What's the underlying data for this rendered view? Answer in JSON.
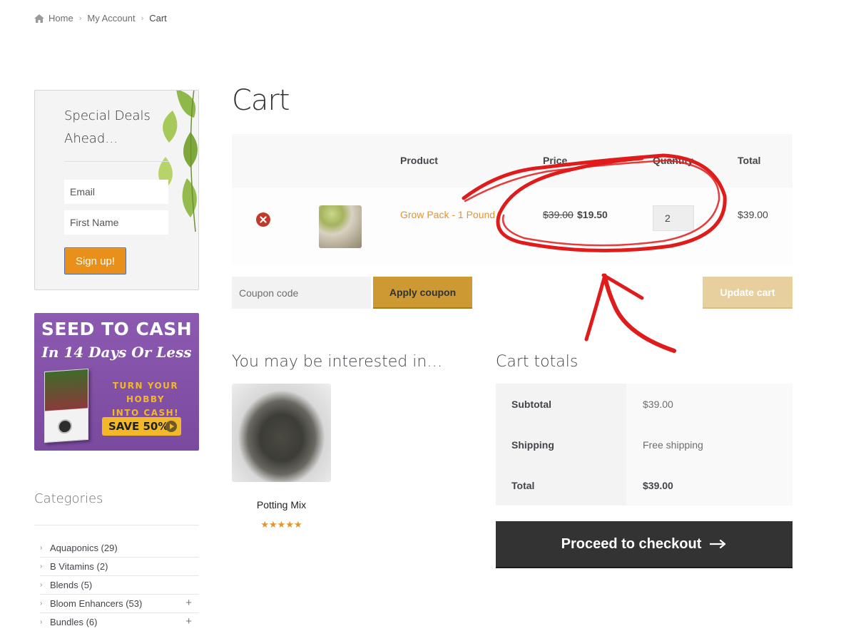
{
  "breadcrumb": {
    "home": "Home",
    "account": "My Account",
    "current": "Cart"
  },
  "newsletter": {
    "title": "Special Deals Ahead…",
    "email_placeholder": "Email",
    "name_placeholder": "First Name",
    "signup_label": "Sign up!"
  },
  "promo": {
    "title": "SEED TO CASH",
    "subtitle": "In 14 Days Or Less",
    "tagline_1": "TURN YOUR HOBBY",
    "tagline_2": "INTO CASH!",
    "save": "SAVE 50%"
  },
  "categories": {
    "title": "Categories",
    "items": [
      {
        "label": "Aquaponics (29)",
        "expandable": false
      },
      {
        "label": "B Vitamins (2)",
        "expandable": false
      },
      {
        "label": "Blends (5)",
        "expandable": false
      },
      {
        "label": "Bloom Enhancers (53)",
        "expandable": true
      },
      {
        "label": "Bundles (6)",
        "expandable": true
      }
    ]
  },
  "cart": {
    "title": "Cart",
    "headers": {
      "product": "Product",
      "price": "Price",
      "quantity": "Quantity",
      "total": "Total"
    },
    "items": [
      {
        "name": "Grow Pack - 1 Pound",
        "old_price": "$39.00",
        "price": "$19.50",
        "quantity": "2",
        "total": "$39.00"
      }
    ],
    "coupon_placeholder": "Coupon code",
    "apply_label": "Apply coupon",
    "update_label": "Update cart"
  },
  "interest": {
    "title": "You may be interested in…",
    "product_name": "Potting Mix",
    "rating": "★★★★★"
  },
  "totals": {
    "title": "Cart totals",
    "subtotal_label": "Subtotal",
    "subtotal_value": "$39.00",
    "shipping_label": "Shipping",
    "shipping_value": "Free shipping",
    "total_label": "Total",
    "total_value": "$39.00"
  },
  "checkout_label": "Proceed to checkout",
  "colors": {
    "accent": "#e4932d",
    "button_gold": "#cc9933",
    "checkout_bg": "#333333",
    "annotation_red": "#e01b1b"
  }
}
